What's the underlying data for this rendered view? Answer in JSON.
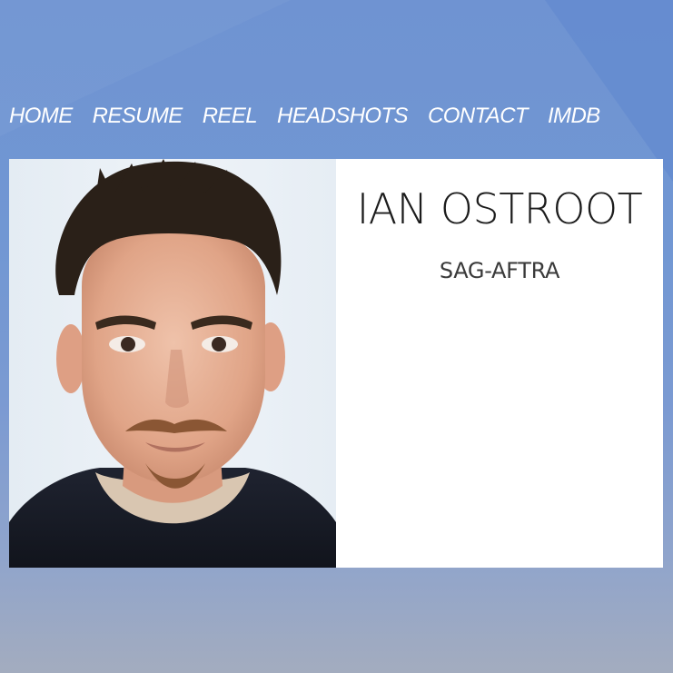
{
  "nav": {
    "items": [
      {
        "label": "HOME"
      },
      {
        "label": "RESUME"
      },
      {
        "label": "REEL"
      },
      {
        "label": "HEADSHOTS"
      },
      {
        "label": "CONTACT"
      },
      {
        "label": "IMDB"
      }
    ]
  },
  "profile": {
    "name": "IAN OSTROOT",
    "union": "SAG-AFTRA"
  },
  "colors": {
    "background_top": "#6f93d2",
    "background_bottom": "#a3acbf",
    "card": "#ffffff",
    "nav_text": "#ffffff"
  }
}
